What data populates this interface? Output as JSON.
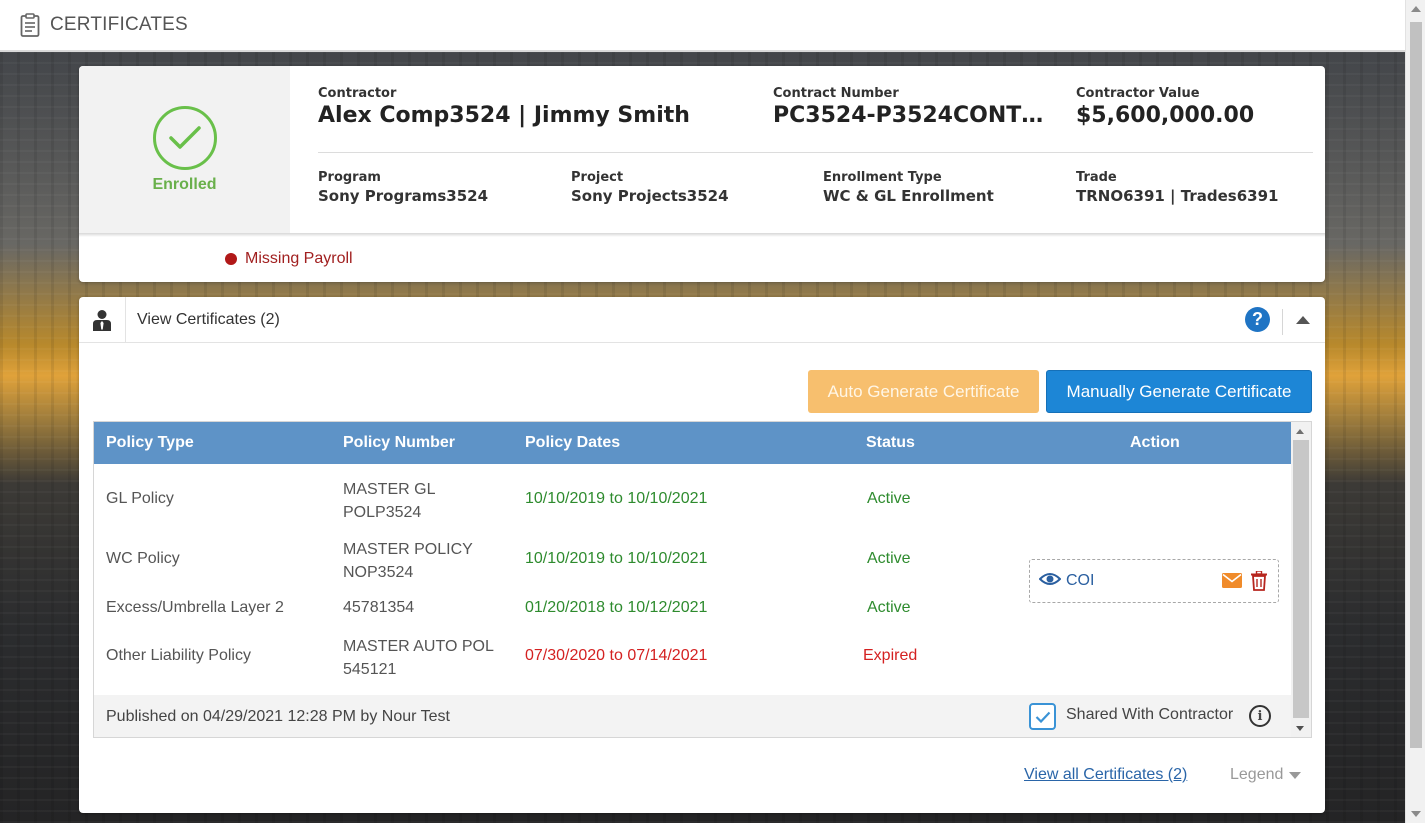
{
  "header": {
    "title": "CERTIFICATES",
    "icon": "clipboard-icon"
  },
  "enrollment": {
    "status": "Enrolled",
    "contractor_label": "Contractor",
    "contractor_value": "Alex Comp3524 | Jimmy Smith",
    "contract_number_label": "Contract Number",
    "contract_number_value": "PC3524-P3524CONTRA...",
    "contractor_value_label": "Contractor Value",
    "contractor_value_value": "$5,600,000.00",
    "program_label": "Program",
    "program_value": "Sony Programs3524",
    "project_label": "Project",
    "project_value": "Sony Projects3524",
    "enrollment_type_label": "Enrollment Type",
    "enrollment_type_value": "WC & GL Enrollment",
    "trade_label": "Trade",
    "trade_value": "TRNO6391 | Trades6391",
    "alert": "Missing Payroll",
    "colors": {
      "enrolled": "#69b04b",
      "alert": "#b11818"
    }
  },
  "certificates": {
    "title": "View Certificates (2)",
    "help_label": "?",
    "auto_generate_label": "Auto Generate Certificate",
    "manual_generate_label": "Manually Generate Certificate",
    "table": {
      "headers": [
        "Policy Type",
        "Policy Number",
        "Policy Dates",
        "Status",
        "Action"
      ],
      "rows": [
        {
          "type": "GL Policy",
          "number": "MASTER GL POLP3524",
          "dates": "10/10/2019 to 10/10/2021",
          "status": "Active"
        },
        {
          "type": "WC Policy",
          "number": "MASTER POLICY NOP3524",
          "dates": "10/10/2019 to 10/10/2021",
          "status": "Active"
        },
        {
          "type": "Excess/Umbrella Layer 2",
          "number": "45781354",
          "dates": "01/20/2018 to 10/12/2021",
          "status": "Active"
        },
        {
          "type": "Other Liability Policy",
          "number": "MASTER AUTO POL 545121",
          "dates": "07/30/2020 to 07/14/2021",
          "status": "Expired"
        }
      ],
      "action_label": "COI",
      "published": "Published on 04/29/2021 12:28 PM by Nour Test",
      "shared_label": "Shared With Contractor",
      "shared_checked": true
    },
    "view_all_label": "View all Certificates (2)",
    "legend_label": "Legend",
    "colors": {
      "header": "#5e93c7",
      "active": "#2e8b2e",
      "expired": "#d42121",
      "primary_button": "#1d86d6",
      "secondary_button": "#f7bf6e"
    }
  }
}
